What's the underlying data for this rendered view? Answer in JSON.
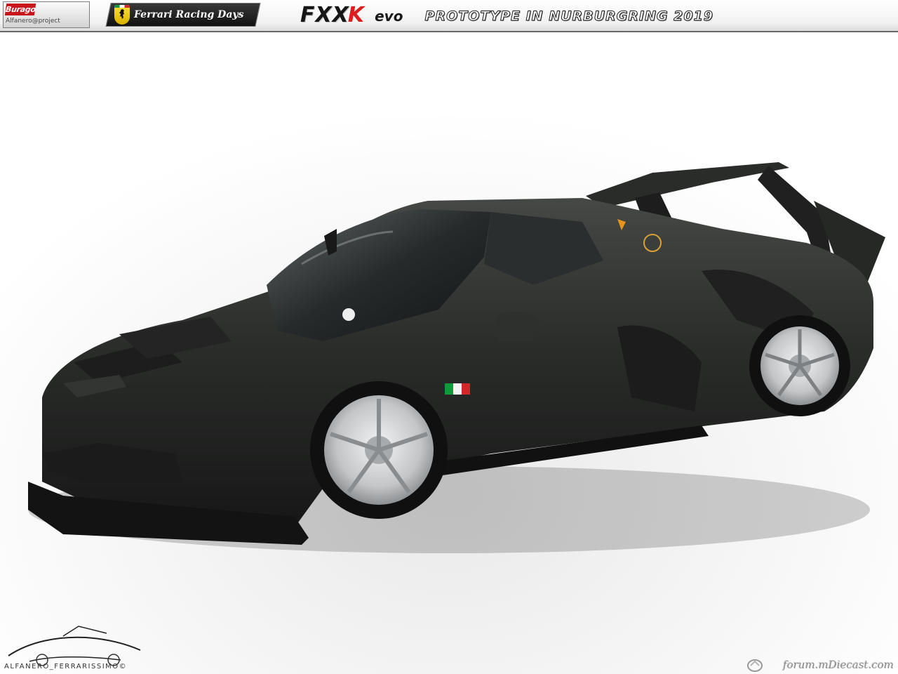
{
  "header": {
    "brand_logo": "Burago",
    "brand_sub": "Alfanero@project",
    "badge_label": "Ferrari Racing Days",
    "model": "FXX",
    "model_accent": "K",
    "variant": "evo",
    "subtitle": "PROTOTYPE IN NURBURGRING 2019"
  },
  "footer": {
    "signature": "ALFANERO_FERRARISSIMO©",
    "watermark": "forum.mDiecast.com"
  },
  "colors": {
    "accent": "#e01d1d",
    "body": "#2a2c2a",
    "wheel": "#c4c6c8"
  },
  "icons": [
    "ferrari-shield-icon",
    "car-silhouette-icon",
    "watermark-icon"
  ]
}
